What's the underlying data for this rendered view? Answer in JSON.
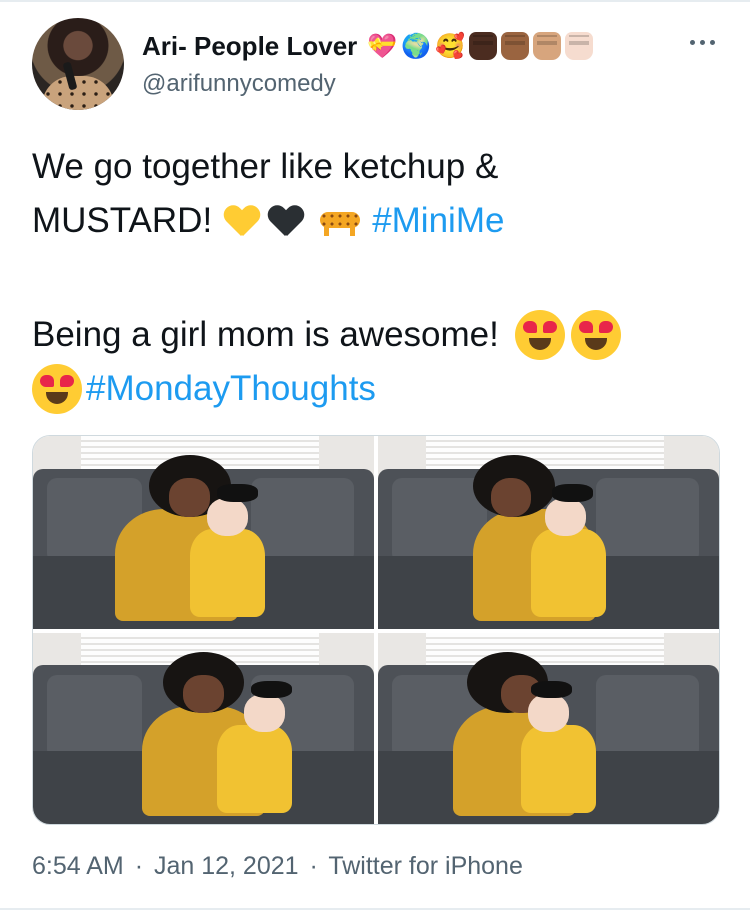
{
  "tweet": {
    "author": {
      "display_name": "Ari- People Lover",
      "handle": "@arifunnycomedy",
      "name_emojis": [
        "heart-with-ribbon",
        "globe",
        "smiling-face-with-hearts",
        "raised-fist-dark",
        "raised-fist-medium-dark",
        "raised-fist-medium-light",
        "raised-fist-light"
      ]
    },
    "text": {
      "line1": "We go together like ketchup &",
      "line2": "MUSTARD!",
      "hashtag1": "#MiniMe",
      "line3": "Being a girl mom is awesome!",
      "hashtag2": "#MondayThoughts"
    },
    "photos": [
      "photo-1",
      "photo-2",
      "photo-3",
      "photo-4"
    ],
    "meta": {
      "time": "6:54 AM",
      "separator1": "·",
      "date": "Jan 12, 2021",
      "separator2": "·",
      "source": "Twitter for iPhone"
    },
    "colors": {
      "hashtag": "#1d9bf0",
      "secondary_text": "#536471",
      "yellow_heart": "#ffcc33",
      "black_heart": "#2a2f33"
    }
  }
}
